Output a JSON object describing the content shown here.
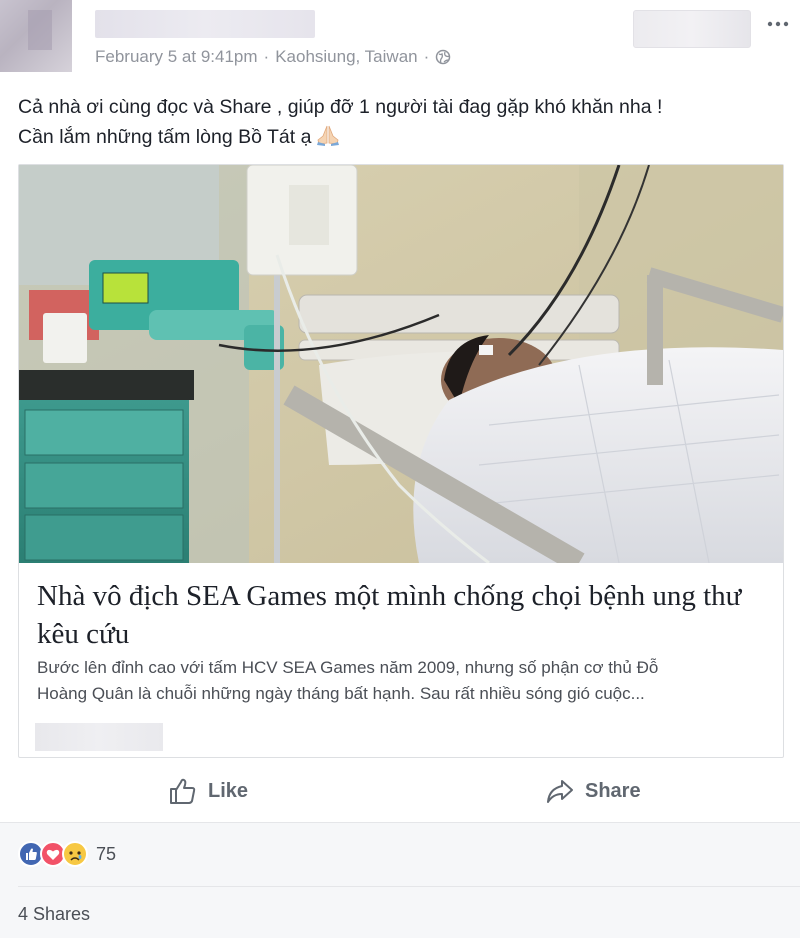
{
  "post": {
    "timestamp": "February 5 at 9:41pm",
    "location": "Kaohsiung, Taiwan",
    "separator": "·",
    "text_lines": [
      "Cả nhà ơi cùng đọc và Share , giúp đỡ 1 người tài đag gặp khó khăn nha !",
      "Cần lắm những tấm lòng Bồ Tát ạ"
    ]
  },
  "card": {
    "title": "Nhà vô địch SEA Games một mình chống chọi bệnh ung thư kêu cứu",
    "description_lines": [
      "Bước lên đỉnh cao với tấm HCV SEA Games năm 2009, nhưng số phận cơ thủ Đỗ",
      "Hoàng Quân là chuỗi những ngày tháng bất hạnh. Sau rất nhiều sóng gió cuộc..."
    ]
  },
  "actions": {
    "like_label": "Like",
    "share_label": "Share"
  },
  "footer": {
    "reaction_count": "75",
    "shares_label": "4 Shares"
  },
  "colors": {
    "like_blue": "#4267b2",
    "love_red": "#f25268",
    "sad_yellow": "#f7c843"
  }
}
